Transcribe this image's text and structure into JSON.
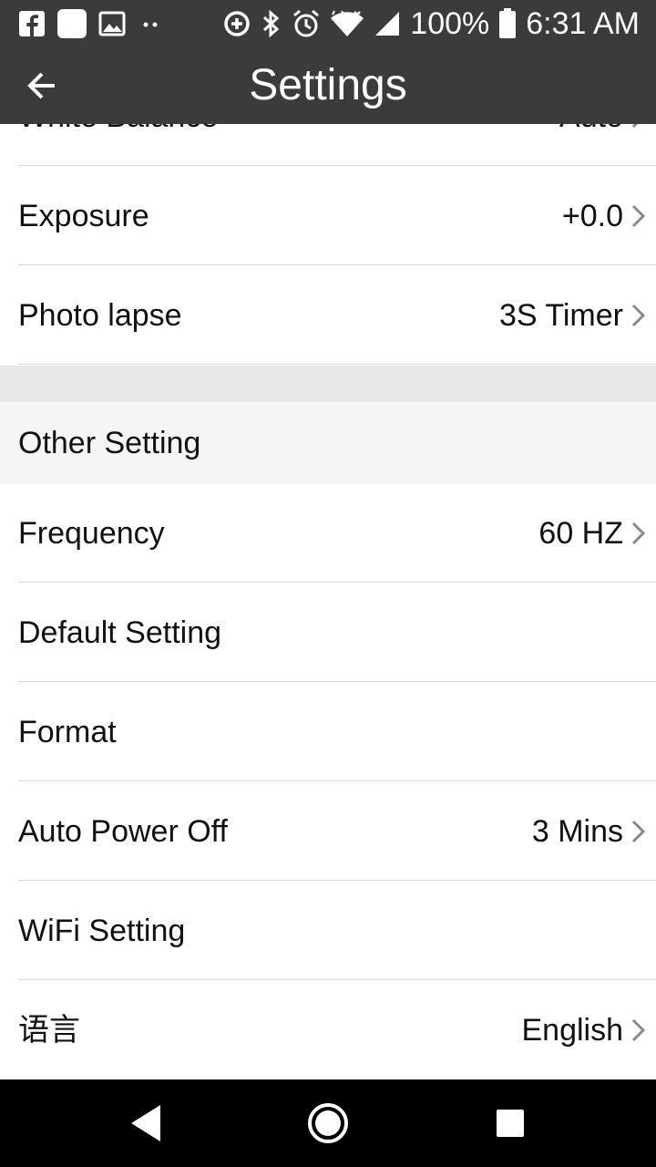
{
  "status_bar": {
    "icons_left": [
      "facebook-icon",
      "app-square-icon",
      "image-icon",
      "more-dots-icon"
    ],
    "icons_right": [
      "data-saver-icon",
      "bluetooth-icon",
      "alarm-icon",
      "wifi-icon",
      "signal-icon"
    ],
    "battery": "100%",
    "time": "6:31 AM"
  },
  "toolbar": {
    "back_icon": "arrow-left-icon",
    "title": "Settings"
  },
  "rows_top": [
    {
      "label": "White Balance",
      "value": "Auto",
      "chevron": true
    },
    {
      "label": "Exposure",
      "value": "+0.0",
      "chevron": true
    },
    {
      "label": "Photo lapse",
      "value": "3S Timer",
      "chevron": true
    }
  ],
  "section": {
    "title": "Other Setting"
  },
  "rows_other": [
    {
      "label": "Frequency",
      "value": "60 HZ",
      "chevron": true
    },
    {
      "label": "Default Setting",
      "value": "",
      "chevron": false
    },
    {
      "label": "Format",
      "value": "",
      "chevron": false
    },
    {
      "label": "Auto Power Off",
      "value": "3 Mins",
      "chevron": true
    },
    {
      "label": "WiFi Setting",
      "value": "",
      "chevron": false
    },
    {
      "label": "语言",
      "value": "English",
      "chevron": true
    }
  ],
  "nav_bar": {
    "buttons": [
      "back-triangle-icon",
      "home-circle-icon",
      "recents-square-icon"
    ]
  },
  "colors": {
    "bar": "#3b3b3d",
    "divider": "#d9d9d9",
    "section_bg": "#f5f5f5",
    "gap_bg": "#e8e8e8",
    "chevron": "#8a8a8a"
  }
}
